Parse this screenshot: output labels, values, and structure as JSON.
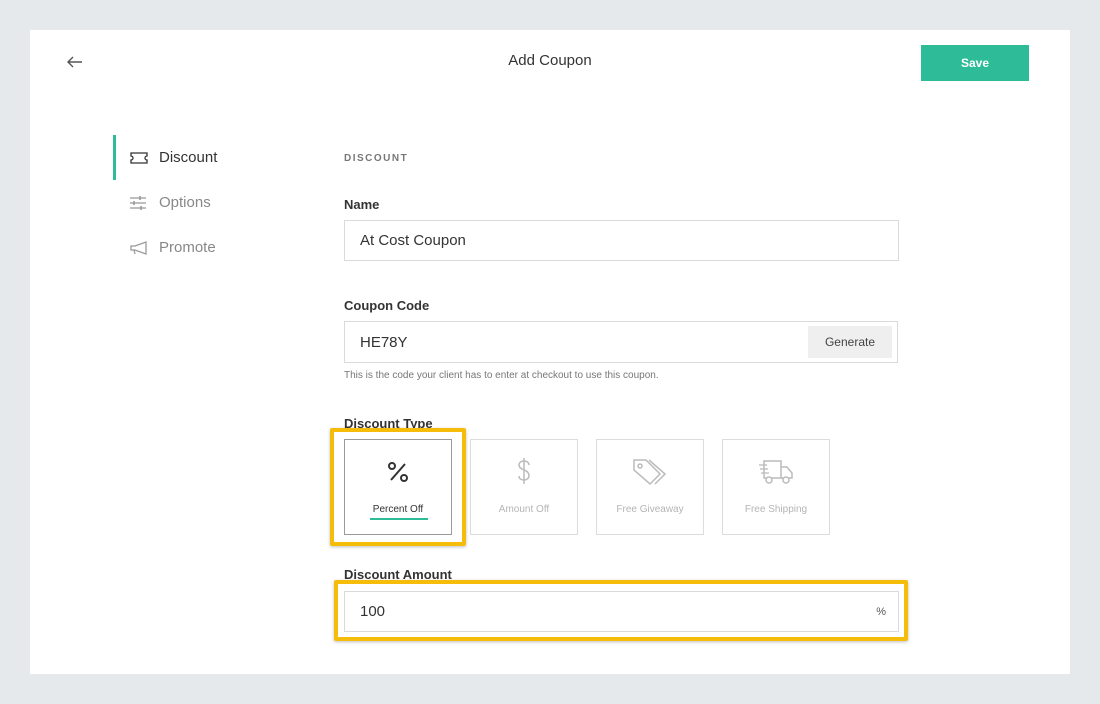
{
  "header": {
    "title": "Add Coupon",
    "save_label": "Save"
  },
  "sidebar": {
    "items": [
      {
        "label": "Discount",
        "icon": "ticket-icon",
        "active": true
      },
      {
        "label": "Options",
        "icon": "sliders-icon",
        "active": false
      },
      {
        "label": "Promote",
        "icon": "megaphone-icon",
        "active": false
      }
    ]
  },
  "form": {
    "section_label": "DISCOUNT",
    "name": {
      "label": "Name",
      "value": "At Cost Coupon"
    },
    "coupon_code": {
      "label": "Coupon Code",
      "value": "HE78Y",
      "generate_label": "Generate",
      "helper": "This is the code your client has to enter at checkout to use this coupon."
    },
    "discount_type": {
      "label": "Discount Type",
      "options": [
        {
          "label": "Percent Off",
          "icon": "percent-icon",
          "selected": true
        },
        {
          "label": "Amount Off",
          "icon": "dollar-icon",
          "selected": false
        },
        {
          "label": "Free Giveaway",
          "icon": "tags-icon",
          "selected": false
        },
        {
          "label": "Free Shipping",
          "icon": "truck-icon",
          "selected": false
        }
      ]
    },
    "discount_amount": {
      "label": "Discount Amount",
      "value": "100",
      "unit": "%"
    }
  },
  "colors": {
    "accent": "#2ebc98",
    "highlight": "#f5bd0a",
    "background": "#e6e9ec"
  }
}
